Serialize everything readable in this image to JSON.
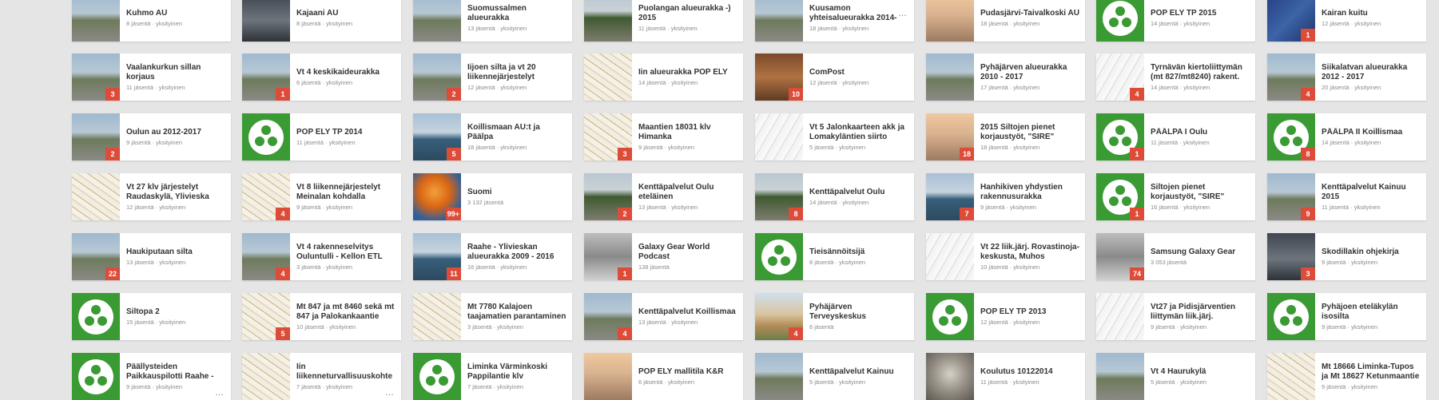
{
  "communities": [
    [
      {
        "title": "Kuhmo AU",
        "meta": "8 jäsentä · yksityinen",
        "thumb": "photo-road",
        "badge": ""
      },
      {
        "title": "Kajaani AU",
        "meta": "8 jäsentä · yksityinen",
        "thumb": "photo-dark",
        "badge": ""
      },
      {
        "title": "Suomussalmen alueurakka",
        "meta": "13 jäsentä · yksityinen",
        "thumb": "photo-road",
        "badge": ""
      },
      {
        "title": "Puolangan alueurakka -) 2015",
        "meta": "11 jäsentä · yksityinen",
        "thumb": "photo-forest",
        "badge": ""
      },
      {
        "title": "Kuusamon yhteisalueurakka 2014-",
        "meta": "18 jäsentä · yksityinen",
        "thumb": "photo-road",
        "badge": "",
        "more": true
      },
      {
        "title": "Pudasjärvi-Taivalkoski AU",
        "meta": "18 jäsentä · yksityinen",
        "thumb": "photo-warm",
        "badge": ""
      },
      {
        "title": "POP ELY TP 2015",
        "meta": "14 jäsentä · yksityinen",
        "thumb": "green",
        "badge": ""
      },
      {
        "title": "Kairan kuitu",
        "meta": "12 jäsentä · yksityinen",
        "thumb": "photo-blue",
        "badge": "1"
      }
    ],
    [
      {
        "title": "Vaalankurkun sillan korjaus",
        "meta": "11 jäsentä · yksityinen",
        "thumb": "photo-road",
        "badge": "3"
      },
      {
        "title": "Vt 4 keskikaideurakka",
        "meta": "6 jäsentä · yksityinen",
        "thumb": "photo-road",
        "badge": "1"
      },
      {
        "title": "Iijoen silta ja vt 20 liikennejärjestelyt",
        "meta": "12 jäsentä · yksityinen",
        "thumb": "photo-road",
        "badge": "2"
      },
      {
        "title": "Iin alueurakka POP ELY",
        "meta": "14 jäsentä · yksityinen",
        "thumb": "photo-map",
        "badge": ""
      },
      {
        "title": "ComPost",
        "meta": "12 jäsentä · yksityinen",
        "thumb": "photo-brown",
        "badge": "10"
      },
      {
        "title": "Pyhäjärven alueurakka 2010 - 2017",
        "meta": "17 jäsentä · yksityinen",
        "thumb": "photo-road",
        "badge": ""
      },
      {
        "title": "Tyrnävän kiertoliittymän (mt 827/mt8240) rakent.",
        "meta": "14 jäsentä · yksityinen",
        "thumb": "photo-sketch",
        "badge": "4"
      },
      {
        "title": "Siikalatvan alueurakka 2012 - 2017",
        "meta": "20 jäsentä · yksityinen",
        "thumb": "photo-road",
        "badge": "4"
      }
    ],
    [
      {
        "title": "Oulun au 2012-2017",
        "meta": "9 jäsentä · yksityinen",
        "thumb": "photo-road",
        "badge": "2"
      },
      {
        "title": "POP ELY TP 2014",
        "meta": "11 jäsentä · yksityinen",
        "thumb": "green",
        "badge": ""
      },
      {
        "title": "Koillismaan AU:t ja Päälpa",
        "meta": "18 jäsentä · yksityinen",
        "thumb": "photo-water",
        "badge": "5"
      },
      {
        "title": "Maantien 18031 klv Himanka",
        "meta": "9 jäsentä · yksityinen",
        "thumb": "photo-map",
        "badge": "3"
      },
      {
        "title": "Vt 5 Jalonkaarteen akk ja Lomakyläntien siirto",
        "meta": "5 jäsentä · yksityinen",
        "thumb": "photo-sketch",
        "badge": ""
      },
      {
        "title": "2015 Siltojen pienet korjaustyöt, \"SIRE\"",
        "meta": "18 jäsentä · yksityinen",
        "thumb": "photo-warm",
        "badge": "18"
      },
      {
        "title": "PÄÄLPA I Oulu",
        "meta": "11 jäsentä · yksityinen",
        "thumb": "green",
        "badge": "1"
      },
      {
        "title": "PÄÄLPA II Koillismaa",
        "meta": "14 jäsentä · yksityinen",
        "thumb": "green",
        "badge": "8"
      }
    ],
    [
      {
        "title": "Vt 27 klv järjestelyt Raudaskylä, Ylivieska",
        "meta": "12 jäsentä · yksityinen",
        "thumb": "photo-map",
        "badge": ""
      },
      {
        "title": "Vt 8 liikennejärjestelyt Meinalan kohdalla",
        "meta": "9 jäsentä · yksityinen",
        "thumb": "photo-map",
        "badge": "4"
      },
      {
        "title": "Suomi",
        "meta": "3 132 jäsentä",
        "thumb": "photo-orange",
        "badge": "99+"
      },
      {
        "title": "Kenttäpalvelut Oulu eteläinen",
        "meta": "13 jäsentä · yksityinen",
        "thumb": "photo-forest",
        "badge": "2"
      },
      {
        "title": "Kenttäpalvelut Oulu",
        "meta": "14 jäsentä · yksityinen",
        "thumb": "photo-forest",
        "badge": "8"
      },
      {
        "title": "Hanhikiven yhdystien rakennusurakka",
        "meta": "9 jäsentä · yksityinen",
        "thumb": "photo-water",
        "badge": "7"
      },
      {
        "title": "Siltojen pienet korjaustyöt, \"SIRE\"",
        "meta": "16 jäsentä · yksityinen",
        "thumb": "green",
        "badge": "1"
      },
      {
        "title": "Kenttäpalvelut Kainuu 2015",
        "meta": "11 jäsentä · yksityinen",
        "thumb": "photo-road",
        "badge": "9"
      }
    ],
    [
      {
        "title": "Haukiputaan silta",
        "meta": "13 jäsentä · yksityinen",
        "thumb": "photo-road",
        "badge": "22"
      },
      {
        "title": "Vt 4 rakenneselvitys Ouluntulli - Kellon ETL",
        "meta": "3 jäsentä · yksityinen",
        "thumb": "photo-road",
        "badge": "4"
      },
      {
        "title": "Raahe - Ylivieskan alueurakka 2009 - 2016",
        "meta": "16 jäsentä · yksityinen",
        "thumb": "photo-water",
        "badge": "11"
      },
      {
        "title": "Galaxy Gear World Podcast",
        "meta": "138 jäsentä",
        "thumb": "photo-tech",
        "badge": "1"
      },
      {
        "title": "Tieisännöitsijä",
        "meta": "8 jäsentä · yksityinen",
        "thumb": "green",
        "badge": ""
      },
      {
        "title": "Vt 22 liik.järj. Rovastinoja-keskusta, Muhos",
        "meta": "10 jäsentä · yksityinen",
        "thumb": "photo-sketch",
        "badge": ""
      },
      {
        "title": "Samsung Galaxy Gear",
        "meta": "3 053 jäsentä",
        "thumb": "photo-tech",
        "badge": "74"
      },
      {
        "title": "Skodillakin ohjekirja",
        "meta": "9 jäsentä · yksityinen",
        "thumb": "photo-dark",
        "badge": "3"
      }
    ],
    [
      {
        "title": "Siltopa 2",
        "meta": "15 jäsentä · yksityinen",
        "thumb": "green",
        "badge": ""
      },
      {
        "title": "Mt 847 ja mt 8460 sekä mt 847 ja Palokankaantie",
        "meta": "10 jäsentä · yksityinen",
        "thumb": "photo-map",
        "badge": "5"
      },
      {
        "title": "Mt 7780 Kalajoen taajamatien parantaminen",
        "meta": "3 jäsentä · yksityinen",
        "thumb": "photo-map",
        "badge": ""
      },
      {
        "title": "Kenttäpalvelut Koillismaa",
        "meta": "13 jäsentä · yksityinen",
        "thumb": "photo-road",
        "badge": "4"
      },
      {
        "title": "Pyhäjärven Terveyskeskus",
        "meta": "6 jäsentä",
        "thumb": "photo-building",
        "badge": "4"
      },
      {
        "title": "POP ELY TP 2013",
        "meta": "12 jäsentä · yksityinen",
        "thumb": "green",
        "badge": ""
      },
      {
        "title": "Vt27 ja Pidisjärventien liittymän liik.järj.",
        "meta": "9 jäsentä · yksityinen",
        "thumb": "photo-sketch",
        "badge": ""
      },
      {
        "title": "Pyhäjoen eteläkylän isosilta",
        "meta": "9 jäsentä · yksityinen",
        "thumb": "green",
        "badge": ""
      }
    ],
    [
      {
        "title": "Päällysteiden Paikkauspilotti Raahe -",
        "meta": "9 jäsentä · yksityinen",
        "thumb": "green",
        "badge": "",
        "more": "low"
      },
      {
        "title": "Iin liikenneturvallisuuskohte",
        "meta": "7 jäsentä · yksityinen",
        "thumb": "photo-map",
        "badge": "",
        "more": "low"
      },
      {
        "title": "Liminka Värminkoski Pappilantie klv",
        "meta": "7 jäsentä · yksityinen",
        "thumb": "green",
        "badge": ""
      },
      {
        "title": "POP ELY mallitila K&R",
        "meta": "6 jäsentä · yksityinen",
        "thumb": "photo-warm",
        "badge": ""
      },
      {
        "title": "Kenttäpalvelut Kainuu",
        "meta": "5 jäsentä · yksityinen",
        "thumb": "photo-road",
        "badge": ""
      },
      {
        "title": "Koulutus 10122014",
        "meta": "11 jäsentä · yksityinen",
        "thumb": "photo-animal",
        "badge": ""
      },
      {
        "title": "Vt 4 Haurukylä",
        "meta": "5 jäsentä · yksityinen",
        "thumb": "photo-road",
        "badge": ""
      },
      {
        "title": "Mt 18666 Liminka-Tupos ja Mt 18627 Ketunmaantie",
        "meta": "9 jäsentä · yksityinen",
        "thumb": "photo-map",
        "badge": ""
      }
    ]
  ]
}
